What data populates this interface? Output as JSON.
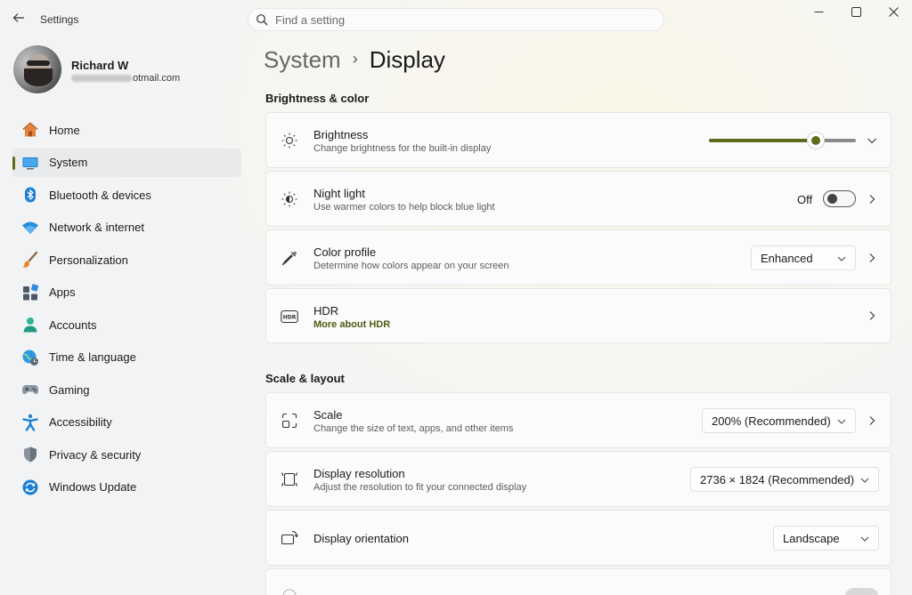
{
  "titlebar": {
    "app_title": "Settings",
    "back_icon": "arrow-left-icon"
  },
  "search": {
    "placeholder": "Find a setting"
  },
  "profile": {
    "name": "Richard W",
    "email_visible": "otmail.com"
  },
  "nav": {
    "items": [
      {
        "label": "Home",
        "icon": "home-icon"
      },
      {
        "label": "System",
        "icon": "system-icon",
        "active": true
      },
      {
        "label": "Bluetooth & devices",
        "icon": "bluetooth-icon"
      },
      {
        "label": "Network & internet",
        "icon": "wifi-icon"
      },
      {
        "label": "Personalization",
        "icon": "brush-icon"
      },
      {
        "label": "Apps",
        "icon": "apps-icon"
      },
      {
        "label": "Accounts",
        "icon": "person-icon"
      },
      {
        "label": "Time & language",
        "icon": "globe-clock-icon"
      },
      {
        "label": "Gaming",
        "icon": "gamepad-icon"
      },
      {
        "label": "Accessibility",
        "icon": "accessibility-icon"
      },
      {
        "label": "Privacy & security",
        "icon": "shield-icon"
      },
      {
        "label": "Windows Update",
        "icon": "update-icon"
      }
    ]
  },
  "breadcrumb": {
    "parent": "System",
    "separator": "›",
    "current": "Display"
  },
  "sections": {
    "brightness_color": "Brightness & color",
    "scale_layout": "Scale & layout"
  },
  "cards": {
    "brightness": {
      "title": "Brightness",
      "subtitle": "Change brightness for the built-in display",
      "level": 0.73
    },
    "night_light": {
      "title": "Night light",
      "subtitle": "Use warmer colors to help block blue light",
      "state": "Off"
    },
    "color_profile": {
      "title": "Color profile",
      "subtitle": "Determine how colors appear on your screen",
      "value": "Enhanced"
    },
    "hdr": {
      "title": "HDR",
      "link": "More about HDR"
    },
    "scale": {
      "title": "Scale",
      "subtitle": "Change the size of text, apps, and other items",
      "value": "200% (Recommended)"
    },
    "resolution": {
      "title": "Display resolution",
      "subtitle": "Adjust the resolution to fit your connected display",
      "value": "2736 × 1824 (Recommended)"
    },
    "orientation": {
      "title": "Display orientation",
      "value": "Landscape"
    }
  },
  "colors": {
    "accent": "#5f6b1c",
    "link": "#4e5b12"
  }
}
